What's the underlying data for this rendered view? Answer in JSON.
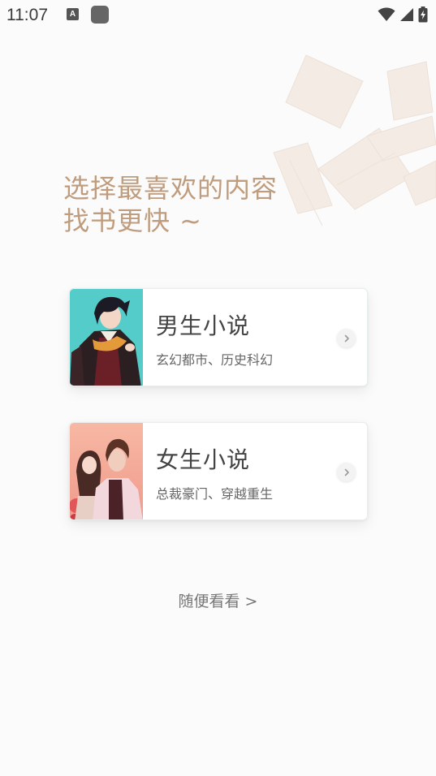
{
  "status_bar": {
    "time": "11:07",
    "notification_icon_letter": "A",
    "icons": [
      "a-notification-icon",
      "app-square-icon",
      "wifi-icon",
      "cellular-signal-icon",
      "battery-charging-icon"
    ]
  },
  "header": {
    "line1": "选择最喜欢的内容",
    "line2": "找书更快 ~",
    "color": "#bf9c7d"
  },
  "categories": [
    {
      "title": "男生小说",
      "subtitle": "玄幻都市、历史科幻",
      "arrow_icon": "chevron-right-icon"
    },
    {
      "title": "女生小说",
      "subtitle": "总裁豪门、穿越重生",
      "arrow_icon": "chevron-right-icon"
    }
  ],
  "browse_link": "随便看看 >"
}
